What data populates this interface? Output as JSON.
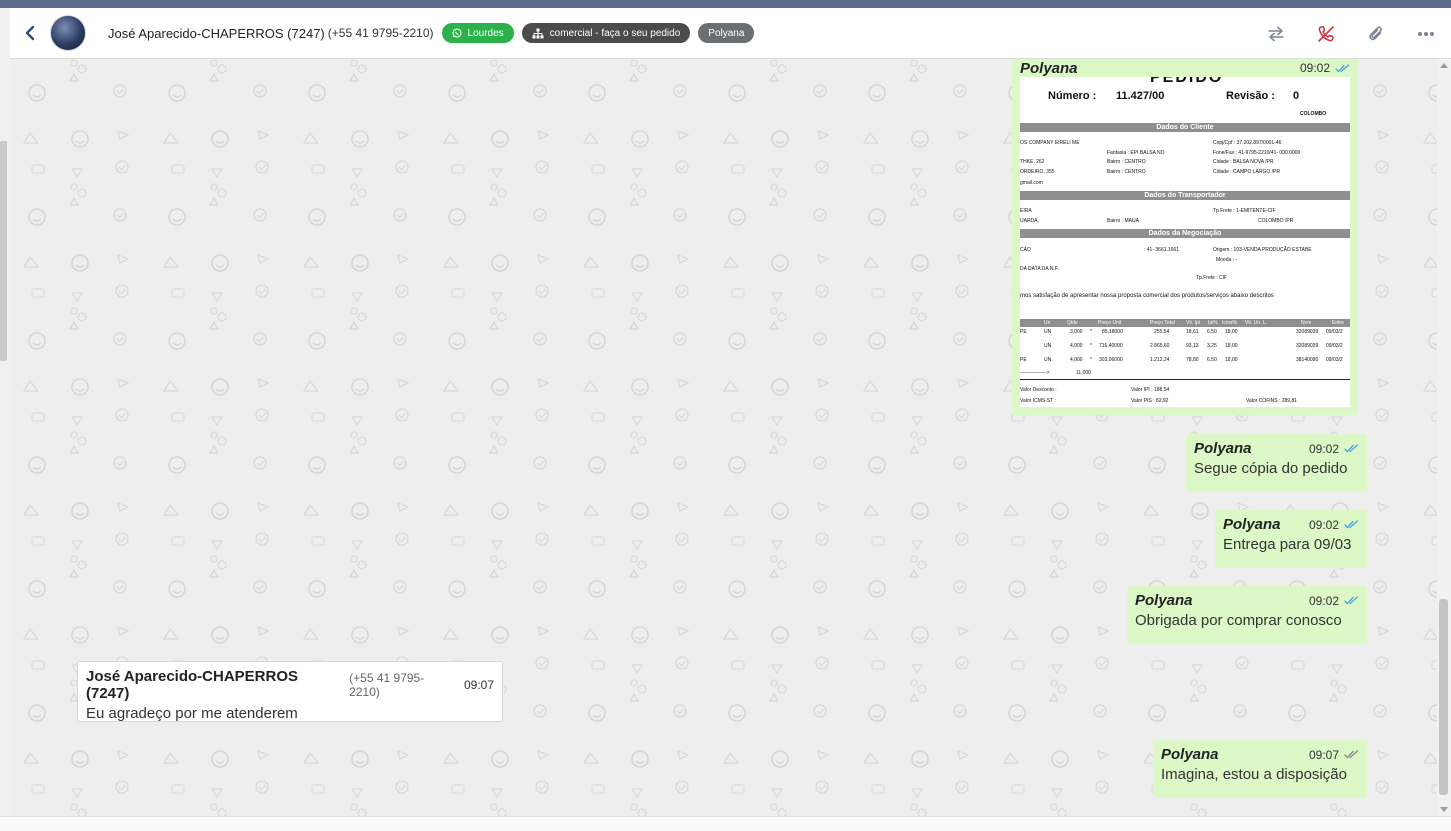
{
  "header": {
    "contact_name": "José Aparecido-CHAPERROS (7247)",
    "contact_phone": "(+55 41 9795-2210)",
    "tags": [
      {
        "label": "Lourdes",
        "icon": "whatsapp-icon",
        "color": "#2bb04a"
      },
      {
        "label": "comercial - faça o seu pedido",
        "icon": "sitemap-icon",
        "color": "#4b4b4b"
      },
      {
        "label": "Polyana",
        "icon": "",
        "color": "#6b6f74"
      }
    ],
    "actions": [
      "transfer-icon",
      "end-call-icon",
      "attach-icon",
      "more-icon"
    ]
  },
  "image_message": {
    "sender": "Polyana",
    "time": "09:02",
    "doc": {
      "title": "PEDIDO",
      "numero_label": "Número :",
      "numero": "11.427/00",
      "revisao_label": "Revisão :",
      "revisao": "0",
      "city": "COLOMBO",
      "sec_cliente": "Dados do Cliente",
      "sec_transportador": "Dados do Transportador",
      "sec_negociacao": "Dados da Negociação",
      "cliente_lines": [
        "OS COMPANY EIRELI ME",
        "THKE, 262",
        "ORDEIRO, 355",
        "gmail.com"
      ],
      "cnpj": "Cnpj/Cpf   :  37.202.897/0001-46",
      "fantasia": "Fantasia  :  EPI BALSA NO",
      "fone": "Fone/Fax  :  41-9795-2210/41- 000.0000",
      "bairro1": "Bairro   :  CENTRO",
      "cidade1": "Cidade   :  BALSA NOVA      /PR",
      "bairro2": "Bairro   :  CENTRO",
      "cidade2": "Cidade   :  CAMPO LARGO      /PR",
      "transp1": "EIRA",
      "transp2": "UARDA,",
      "tpfrete": "Tp.Frete   :  1-EMITENTE-CIF",
      "bairro3": "Bairro   :  MAUA",
      "cidade3": "COLOMBO      /PR",
      "neg1": "CAO",
      "neg_fone": ":  41- 3661.1661",
      "origem": "Origem   :  103-VENDA PRODUÇÃO ESTABE",
      "moeda": "Moeda   :  -",
      "neg2": "DA DATA DA N.F.",
      "tpfrete2": "Tp.Frete   :  CIF",
      "proposta": "mos satisfação de apresentar nossa proposta comercial dos produtos/serviços abaixo descritos",
      "cols": [
        "Un",
        "Qtde",
        "Preço Unit",
        "Preço Total",
        "Vlr. Ipi",
        "Ipi%",
        "Icms%",
        "Vlr. Un. L.",
        "Ncm",
        "Entre"
      ],
      "rows": [
        [
          "PE",
          "UN",
          "3,000",
          "*",
          "85,18000",
          "255,54",
          "18,61",
          "6,50",
          "18,00",
          "32089039",
          "09/03/2"
        ],
        [
          "",
          "UN",
          "4,000",
          "*",
          "716,40000",
          "2.865,60",
          "93,13",
          "3,25",
          "18,00",
          "32089039",
          "09/03/2"
        ],
        [
          "PE",
          "UN",
          "4,000",
          "*",
          "303,06000",
          "1.212,24",
          "78,80",
          "6,50",
          "18,00",
          "38140090",
          "09/03/2"
        ]
      ],
      "total_arrow": "---------------->",
      "total_qty": "11,000",
      "valor_desconto": "Valor Desconto   :",
      "valor_icms_st": "Valor ICMS-ST   :",
      "valor_ipi": "Valor IPI    :     188,54",
      "valor_pis": "Valor PIS    :     82,92",
      "valor_cofins": "Valor COFINS    :     289,81"
    }
  },
  "messages": [
    {
      "sender": "Polyana",
      "time": "09:02",
      "text": "Segue cópia do pedido",
      "read": true
    },
    {
      "sender": "Polyana",
      "time": "09:02",
      "text": "Entrega para 09/03",
      "read": true
    },
    {
      "sender": "Polyana",
      "time": "09:02",
      "text": "Obrigada por comprar conosco",
      "read": true
    },
    {
      "sender": "José Aparecido-CHAPERROS (7247)",
      "phone": "(+55 41 9795-2210)",
      "time": "09:07",
      "text": "Eu agradeço por me atenderem"
    },
    {
      "sender": "Polyana",
      "time": "09:07",
      "text": "Imagina, estou a disposição",
      "read": false
    }
  ],
  "colors": {
    "outgoing_bubble": "#dcf8c6",
    "incoming_bubble": "#ffffff",
    "read_tick": "#4fa3e0",
    "unread_tick": "#8a8a8a",
    "accent": "#2b4c7e"
  }
}
